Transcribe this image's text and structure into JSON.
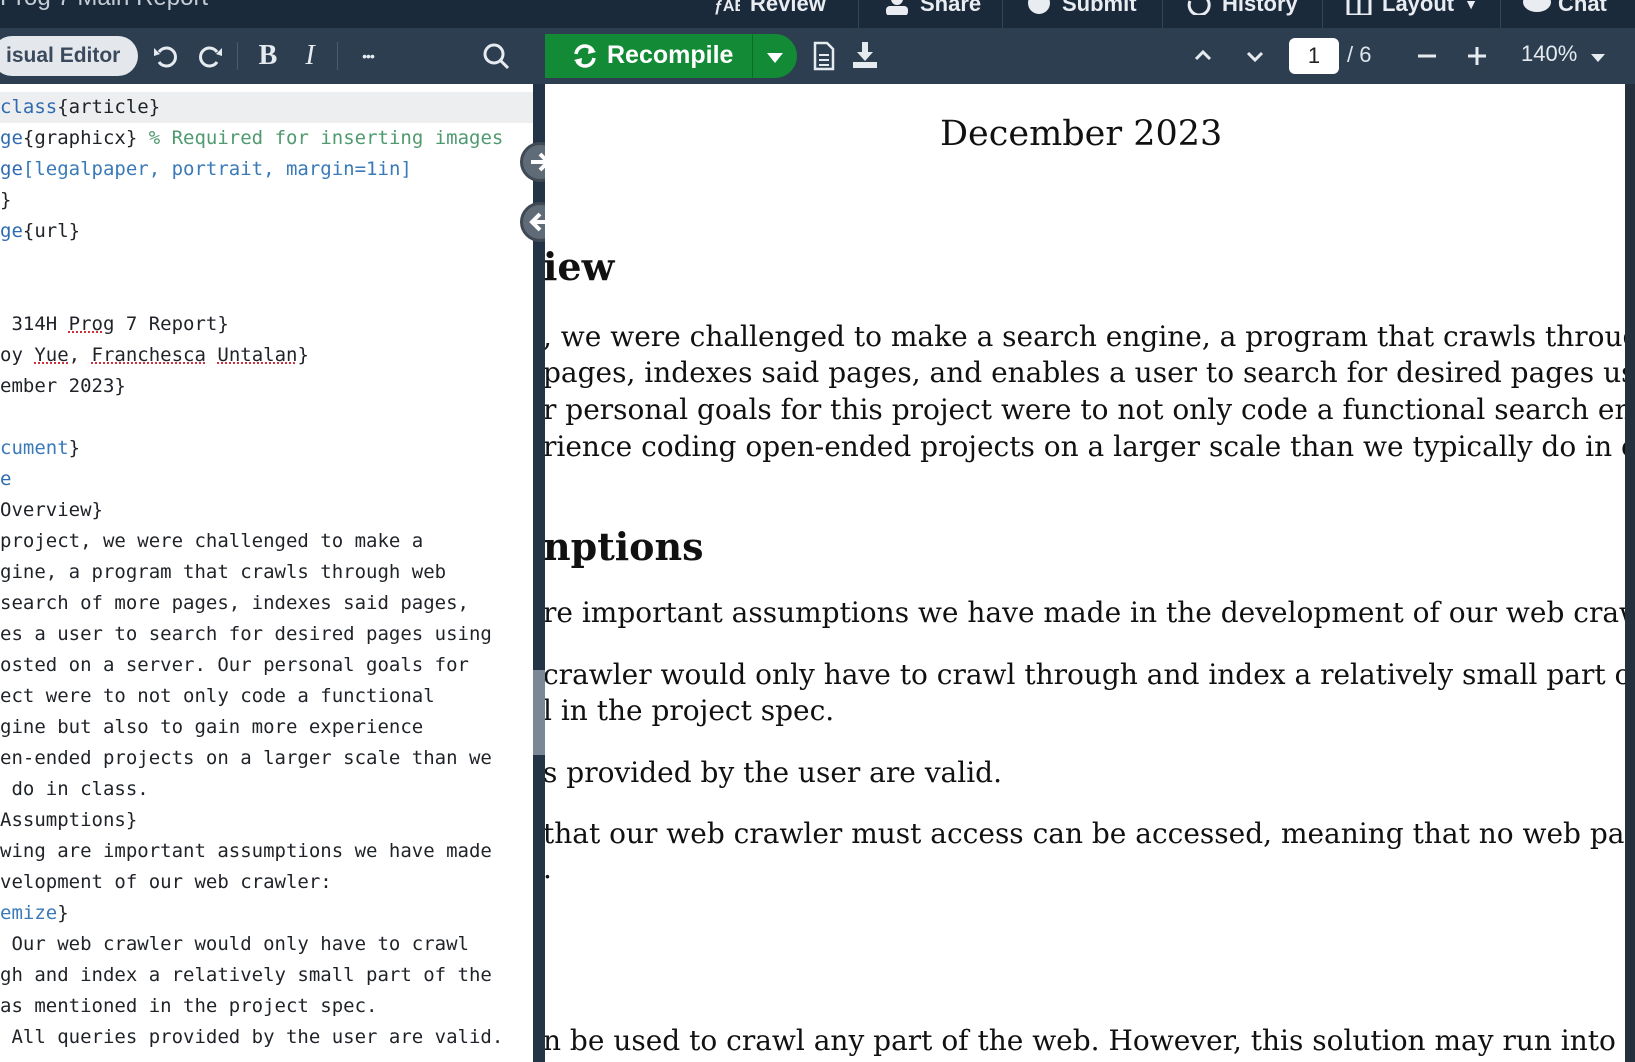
{
  "project": {
    "title": "Prog 7 Main Report"
  },
  "topbar": {
    "review_label": "Review",
    "share_label": "Share",
    "submit_label": "Submit",
    "history_label": "History",
    "layout_label": "Layout",
    "chat_label": "Chat"
  },
  "editor_toolbar": {
    "visual_editor_label": "isual Editor",
    "undo_icon": "undo-icon",
    "redo_icon": "redo-icon",
    "bold_label": "B",
    "italic_label": "I",
    "more_label": "•••"
  },
  "pdf_toolbar": {
    "recompile_label": "Recompile",
    "current_page": "1",
    "page_total": "/ 6",
    "zoom_level": "140%"
  },
  "editor": {
    "lines": [
      {
        "p1": "class",
        "p2": "{article}"
      },
      {
        "p1": "ge",
        "p2": "{graphicx} ",
        "p3": "% Required for inserting images"
      },
      {
        "p1": "ge",
        "p2": "[legalpaper, portrait, margin=1in]",
        "p3": ""
      },
      {
        "p1": "}"
      },
      {
        "p1": "ge",
        "p2": "{url}"
      },
      {
        "p1": ""
      },
      {
        "p1": ""
      },
      {
        "p1": " 314H ",
        "s1": "Prog",
        "p2": " 7 Report}"
      },
      {
        "p1": "oy ",
        "s1": "Yue",
        "p2": ", ",
        "s2": "Franchesca",
        "p3": " ",
        "s3": "Untalan",
        "p4": "}"
      },
      {
        "p1": "ember 2023}"
      },
      {
        "p1": ""
      },
      {
        "p1": "cument",
        "p2": "}"
      },
      {
        "p1": "e"
      },
      {
        "p1": "Overview}"
      },
      {
        "p1": "project, we were challenged to make a"
      },
      {
        "p1": "gine, a program that crawls through web"
      },
      {
        "p1": "search of more pages, indexes said pages,"
      },
      {
        "p1": "es a user to search for desired pages using"
      },
      {
        "p1": "osted on a server. Our personal goals for"
      },
      {
        "p1": "ect were to not only code a functional"
      },
      {
        "p1": "gine but also to gain more experience"
      },
      {
        "p1": "en-ended projects on a larger scale than we"
      },
      {
        "p1": " do in class."
      },
      {
        "p1": "Assumptions}"
      },
      {
        "p1": "wing are important assumptions we have made"
      },
      {
        "p1": "velopment of our web crawler:"
      },
      {
        "p1": "emize",
        "p2": "}"
      },
      {
        "p1": " Our web crawler would only have to crawl"
      },
      {
        "p1": "gh and index a relatively small part of the"
      },
      {
        "p1": "as mentioned in the project spec."
      },
      {
        "p1": " All queries provided by the user are valid."
      }
    ]
  },
  "pdf": {
    "date": "December 2023",
    "heading1": "iew",
    "para1": [
      ", we were challenged to make a search engine, a program that crawls through w",
      "pages, indexes said pages, and enables a user to search for desired pages using qu",
      "r personal goals for this project were to not only code a functional search engine",
      "rience coding open-ended projects on a larger scale than we typically do in class"
    ],
    "heading2": "nptions",
    "para2": "re important assumptions we have made in the development of our web crawler:",
    "item1": [
      "crawler would only have to crawl through and index a relatively small part of",
      "l in the project spec."
    ],
    "item2": "s provided by the user are valid.",
    "item3": [
      "that our web crawler must access can be accessed, meaning that no web pag",
      "."
    ],
    "bottom": "n be used to crawl any part of the web. However, this solution may run into is"
  }
}
